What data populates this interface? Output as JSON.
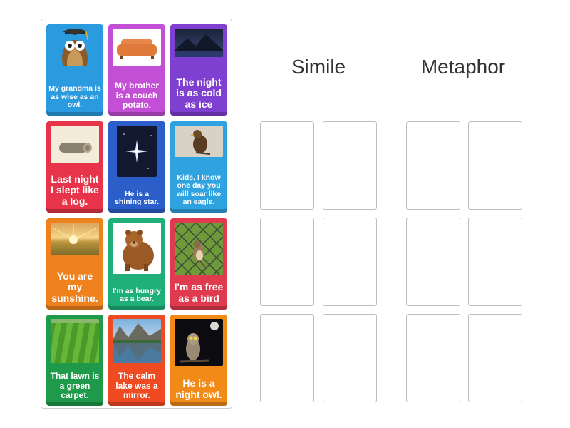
{
  "headings": {
    "simile": "Simile",
    "metaphor": "Metaphor"
  },
  "cards": [
    {
      "text": "My grandma is as wise as an owl.",
      "color": "#2b9be0",
      "image": "graduate-owl-icon"
    },
    {
      "text": "My brother is a couch potato.",
      "color": "#c34fd6",
      "image": "couch-icon"
    },
    {
      "text": "The night is as cold as ice",
      "color": "#7f3fd0",
      "image": "night-mountain-icon"
    },
    {
      "text": "Last night I slept like a log.",
      "color": "#e8344b",
      "image": "log-icon"
    },
    {
      "text": "He is a shining star.",
      "color": "#2b5ec9",
      "image": "star-icon"
    },
    {
      "text": "Kids, I know one day you will soar like an eagle.",
      "color": "#2fa3e0",
      "image": "eagle-icon"
    },
    {
      "text": "You are my sunshine.",
      "color": "#f0821e",
      "image": "sunset-icon"
    },
    {
      "text": "I'm as hungry as a bear.",
      "color": "#1fb07a",
      "image": "bear-icon"
    },
    {
      "text": "I'm as free as a bird",
      "color": "#e03a4e",
      "image": "bird-fence-icon"
    },
    {
      "text": "That lawn is a green carpet.",
      "color": "#1f9a4a",
      "image": "lawn-icon"
    },
    {
      "text": "The calm lake was a mirror.",
      "color": "#f04a22",
      "image": "lake-icon"
    },
    {
      "text": "He is a night owl.",
      "color": "#f28a18",
      "image": "owl-moon-icon"
    }
  ]
}
